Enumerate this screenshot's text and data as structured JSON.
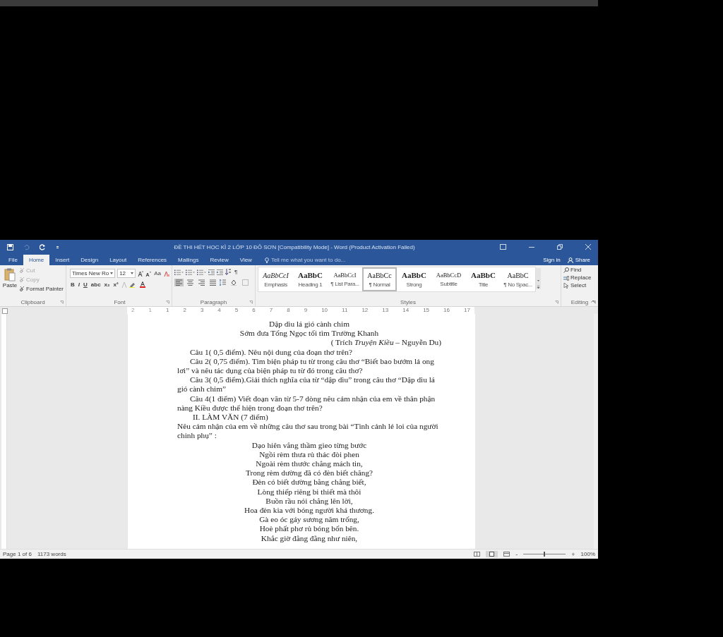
{
  "window": {
    "title": "ĐỀ THI HẾT HỌC KÌ 2 LỚP 10 ĐỖ SƠN [Compatibility Mode] - Word (Product Activation Failed)"
  },
  "tabs": [
    {
      "label": "File",
      "selected": false
    },
    {
      "label": "Home",
      "selected": true
    },
    {
      "label": "Insert",
      "selected": false
    },
    {
      "label": "Design",
      "selected": false
    },
    {
      "label": "Layout",
      "selected": false
    },
    {
      "label": "References",
      "selected": false
    },
    {
      "label": "Mailings",
      "selected": false
    },
    {
      "label": "Review",
      "selected": false
    },
    {
      "label": "View",
      "selected": false
    }
  ],
  "tell_me": {
    "placeholder": "Tell me what you want to do..."
  },
  "account": {
    "sign_in": "Sign in",
    "share": "Share"
  },
  "clipboard": {
    "label": "Clipboard",
    "paste": "Paste",
    "items": [
      {
        "label": "Cut",
        "disabled": true
      },
      {
        "label": "Copy",
        "disabled": true
      },
      {
        "label": "Format Painter",
        "disabled": false
      }
    ]
  },
  "font": {
    "label": "Font",
    "name": "Times New Ro",
    "size": "12",
    "case": "Aa",
    "format_buttons": [
      "B",
      "I",
      "U",
      "abc",
      "x₂",
      "x²"
    ]
  },
  "paragraph": {
    "label": "Paragraph",
    "marks": "¶",
    "alignments": [
      {
        "selected": true
      },
      {
        "selected": false
      },
      {
        "selected": false
      },
      {
        "selected": false
      }
    ]
  },
  "styles": {
    "label": "Styles",
    "items": [
      {
        "preview": "AaBbCcI",
        "name": "Emphasis",
        "kind": "italic",
        "selected": false
      },
      {
        "preview": "AaBbC",
        "name": "Heading 1",
        "kind": "bold",
        "selected": false
      },
      {
        "preview": "AaBbCcI",
        "name": "¶ List Para...",
        "kind": "small",
        "selected": false
      },
      {
        "preview": "AaBbCc",
        "name": "¶ Normal",
        "kind": "plain",
        "selected": true
      },
      {
        "preview": "AaBbC",
        "name": "Strong",
        "kind": "bold",
        "selected": false
      },
      {
        "preview": "AaBbCcD",
        "name": "Subtitle",
        "kind": "small",
        "selected": false
      },
      {
        "preview": "AaBbC",
        "name": "Title",
        "kind": "bold",
        "selected": false
      },
      {
        "preview": "AaBbC",
        "name": "¶ No Spac...",
        "kind": "plain",
        "selected": false
      }
    ]
  },
  "editing": {
    "label": "Editing",
    "items": [
      "Find",
      "Replace",
      "Select"
    ]
  },
  "ruler": {
    "numbers": [
      "2",
      "1",
      "1",
      "2",
      "3",
      "4",
      "5",
      "6",
      "7",
      "8",
      "9",
      "10",
      "11",
      "12",
      "13",
      "14",
      "15",
      "16",
      "17"
    ]
  },
  "document": {
    "lines": [
      {
        "kind": "center",
        "text": "Dập dìu lá gió cành chim"
      },
      {
        "kind": "center",
        "text": "Sớm đưa Tống Ngọc tối tìm Trường Khanh"
      },
      {
        "kind": "right",
        "text": "( Trích *Truyện Kiều* – Nguyễn Du)"
      },
      {
        "kind": "indent",
        "text": "Câu 1( 0,5 điểm). Nêu nội dung của đoạn thơ trên?"
      },
      {
        "kind": "indent",
        "text": "Câu 2( 0,75 điểm). Tìm biện pháp tu từ trong câu thơ “Biết bao bướm lả ong lơi” và nêu tác dụng của biện pháp tu từ đó trong câu thơ?"
      },
      {
        "kind": "indent",
        "text": "Câu 3( 0,5 điểm).Giải thích nghĩa của từ “dập dìu” trong câu thơ “Dập dìu lá gió cành chim”"
      },
      {
        "kind": "indent",
        "text": "Câu 4(1 điểm) Viết đoạn văn từ 5-7 dòng nêu cảm nhận của em về thân phận nàng Kiều được thể hiện trong đoạn thơ trên?"
      },
      {
        "kind": "heading",
        "text": "II. LÀM VĂN (7 điểm)"
      },
      {
        "kind": "left",
        "text": "Nêu cảm nhận của em về những câu thơ sau trong bài “Tình cảnh lẻ loi của người chinh phụ” :"
      },
      {
        "kind": "center",
        "text": "Dạo hiên vắng thầm gieo từng bước"
      },
      {
        "kind": "center",
        "text": "Ngồi rèm thưa rủ thác đòi phen"
      },
      {
        "kind": "center",
        "text": "Ngoài rèm thước chẳng mách tin,"
      },
      {
        "kind": "center",
        "text": "Trong rèm dường đã có đèn biết chăng?"
      },
      {
        "kind": "center",
        "text": "Đèn có biết dường bằng chẳng biết,"
      },
      {
        "kind": "center",
        "text": "Lòng thiếp riêng bi thiết mà thôi"
      },
      {
        "kind": "center",
        "text": "Buồn rầu nói chẳng lên lời,"
      },
      {
        "kind": "center",
        "text": "Hoa đèn kia với bóng người khá thương."
      },
      {
        "kind": "center",
        "text": "Gà eo óc gáy sương năm trống,"
      },
      {
        "kind": "center",
        "text": "Hoè phất phơ rủ bóng bốn bên."
      },
      {
        "kind": "center",
        "text": "Khắc giờ đằng đẵng như niên,"
      }
    ]
  },
  "status_bar": {
    "page": "Page 1 of 6",
    "words": "1173 words",
    "zoom": "100%",
    "zoom_out": "-",
    "zoom_in": "+",
    "zoom_slider": {
      "level": 0.5
    }
  }
}
